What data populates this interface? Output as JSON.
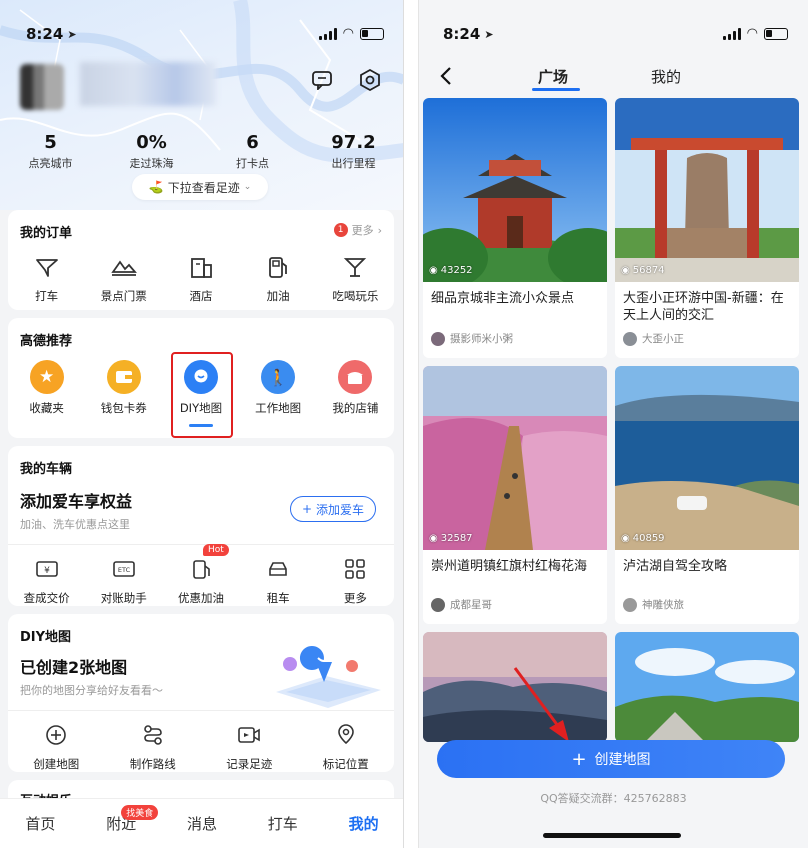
{
  "left": {
    "status_time": "8:24",
    "stats": [
      {
        "value": "5",
        "label": "点亮城市"
      },
      {
        "value": "0%",
        "label": "走过珠海"
      },
      {
        "value": "6",
        "label": "打卡点"
      },
      {
        "value": "97.2",
        "label": "出行里程"
      }
    ],
    "pulldown_label": "下拉查看足迹",
    "orders": {
      "title": "我的订单",
      "badge": "1",
      "more": "更多",
      "items": [
        "打车",
        "景点门票",
        "酒店",
        "加油",
        "吃喝玩乐"
      ]
    },
    "recommend": {
      "title": "高德推荐",
      "items": [
        "收藏夹",
        "钱包卡券",
        "DIY地图",
        "工作地图",
        "我的店铺"
      ]
    },
    "vehicle": {
      "title": "我的车辆",
      "headline": "添加爱车享权益",
      "sub": "加油、洗车优惠点这里",
      "add_button": "添加爱车",
      "items": [
        "查成交价",
        "对账助手",
        "优惠加油",
        "租车",
        "更多"
      ],
      "hot_badge": "Hot"
    },
    "diy": {
      "title": "DIY地图",
      "headline": "已创建2张地图",
      "sub": "把你的地图分享给好友看看～",
      "items": [
        "创建地图",
        "制作路线",
        "记录足迹",
        "标记位置"
      ]
    },
    "peek_title": "互动娱乐",
    "tabs": [
      "首页",
      "附近",
      "消息",
      "打车",
      "我的"
    ],
    "nearby_badge": "找美食"
  },
  "right": {
    "status_time": "8:24",
    "tabs": [
      "广场",
      "我的"
    ],
    "cards": [
      {
        "views": "43252",
        "title": "细品京城非主流小众景点",
        "author": "摄影师米小粥"
      },
      {
        "views": "56874",
        "title": "大歪小正环游中国-新疆：在天上人间的交汇",
        "author": "大歪小正"
      },
      {
        "views": "32587",
        "title": "崇州道明镇红旗村红梅花海",
        "author": "成都星哥"
      },
      {
        "views": "40859",
        "title": "泸沽湖自驾全攻略",
        "author": "神雕侠旅"
      }
    ],
    "create_button": "创建地图",
    "qq_group": "QQ答疑交流群：425762883"
  },
  "colors": {
    "accent": "#1d6ff2",
    "highlight": "#e02020",
    "badge_red": "#f2423c"
  }
}
